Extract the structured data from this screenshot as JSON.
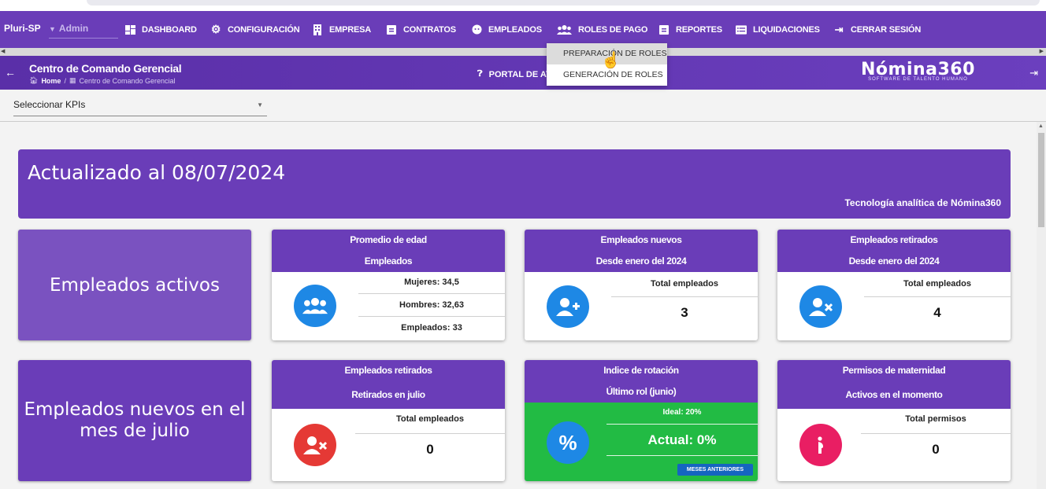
{
  "topnav": {
    "brand": "Pluri-SP",
    "role": "Admin",
    "items": [
      {
        "label": "DASHBOARD",
        "icon": "dashboard-icon"
      },
      {
        "label": "CONFIGURACIÓN",
        "icon": "gear-icon"
      },
      {
        "label": "EMPRESA",
        "icon": "building-icon"
      },
      {
        "label": "CONTRATOS",
        "icon": "clipboard-icon"
      },
      {
        "label": "EMPLEADOS",
        "icon": "face-icon"
      },
      {
        "label": "ROLES DE PAGO",
        "icon": "group-icon"
      },
      {
        "label": "REPORTES",
        "icon": "report-icon"
      },
      {
        "label": "LIQUIDACIONES",
        "icon": "list-icon"
      },
      {
        "label": "CERRAR SESIÓN",
        "icon": "logout-icon"
      }
    ]
  },
  "dropdown": {
    "options": [
      "PREPARACIÓN DE ROLES",
      "GENERACIÓN DE ROLES"
    ]
  },
  "subbar": {
    "title": "Centro de Comando Gerencial",
    "crumb_home": "Home",
    "crumb_current": "Centro de Comando Gerencial",
    "portal": "PORTAL DE AY",
    "logo_name": "Nómina360",
    "logo_tagline": "SOFTWARE DE TALENTO HUMANO"
  },
  "kpi_select": {
    "placeholder": "Seleccionar KPIs"
  },
  "banner": {
    "title": "Actualizado al 08/07/2024",
    "subtitle": "Tecnología analítica de Nómina360"
  },
  "tiles": {
    "activos": "Empleados activos",
    "nuevos_mes": "Empleados nuevos en el mes de julio"
  },
  "cards": {
    "edad": {
      "h1": "Promedio de edad",
      "h2": "Empleados",
      "r1": "Mujeres: 34,5",
      "r2": "Hombres: 32,63",
      "r3": "Empleados: 33"
    },
    "nuevos": {
      "h1": "Empleados nuevos",
      "h2": "Desde enero del 2024",
      "label": "Total empleados",
      "value": "3"
    },
    "retirados": {
      "h1": "Empleados retirados",
      "h2": "Desde enero del 2024",
      "label": "Total empleados",
      "value": "4"
    },
    "retirados_julio": {
      "h1": "Empleados retirados",
      "h2": "Retirados en julio",
      "label": "Total empleados",
      "value": "0"
    },
    "rotacion": {
      "h1": "Indice de rotación",
      "h2": "Último rol (junio)",
      "ideal": "Ideal: 20%",
      "actual": "Actual: 0%",
      "button": "MESES ANTERIORES"
    },
    "maternidad": {
      "h1": "Permisos de maternidad",
      "h2": "Activos en el momento",
      "label": "Total permisos",
      "value": "0"
    }
  },
  "colors": {
    "primary": "#6a3db8",
    "blue": "#1e88e5",
    "red": "#e53935",
    "pink": "#e91e63",
    "green": "#22bb44"
  }
}
